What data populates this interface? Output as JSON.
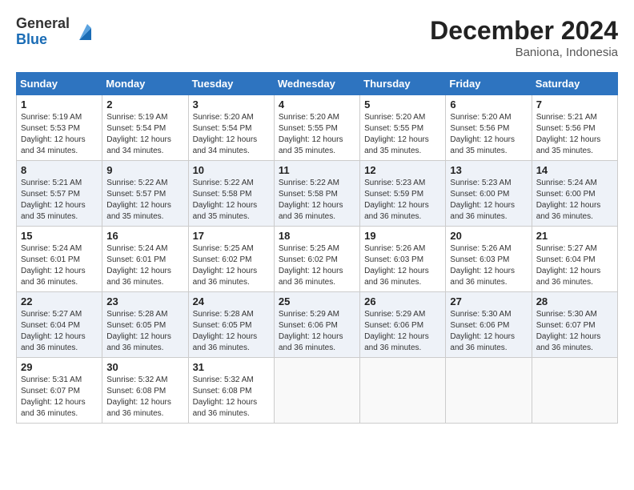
{
  "header": {
    "logo_general": "General",
    "logo_blue": "Blue",
    "month_year": "December 2024",
    "location": "Baniona, Indonesia"
  },
  "weekdays": [
    "Sunday",
    "Monday",
    "Tuesday",
    "Wednesday",
    "Thursday",
    "Friday",
    "Saturday"
  ],
  "weeks": [
    [
      {
        "day": "1",
        "sunrise": "5:19 AM",
        "sunset": "5:53 PM",
        "daylight": "12 hours and 34 minutes."
      },
      {
        "day": "2",
        "sunrise": "5:19 AM",
        "sunset": "5:54 PM",
        "daylight": "12 hours and 34 minutes."
      },
      {
        "day": "3",
        "sunrise": "5:20 AM",
        "sunset": "5:54 PM",
        "daylight": "12 hours and 34 minutes."
      },
      {
        "day": "4",
        "sunrise": "5:20 AM",
        "sunset": "5:55 PM",
        "daylight": "12 hours and 35 minutes."
      },
      {
        "day": "5",
        "sunrise": "5:20 AM",
        "sunset": "5:55 PM",
        "daylight": "12 hours and 35 minutes."
      },
      {
        "day": "6",
        "sunrise": "5:20 AM",
        "sunset": "5:56 PM",
        "daylight": "12 hours and 35 minutes."
      },
      {
        "day": "7",
        "sunrise": "5:21 AM",
        "sunset": "5:56 PM",
        "daylight": "12 hours and 35 minutes."
      }
    ],
    [
      {
        "day": "8",
        "sunrise": "5:21 AM",
        "sunset": "5:57 PM",
        "daylight": "12 hours and 35 minutes."
      },
      {
        "day": "9",
        "sunrise": "5:22 AM",
        "sunset": "5:57 PM",
        "daylight": "12 hours and 35 minutes."
      },
      {
        "day": "10",
        "sunrise": "5:22 AM",
        "sunset": "5:58 PM",
        "daylight": "12 hours and 35 minutes."
      },
      {
        "day": "11",
        "sunrise": "5:22 AM",
        "sunset": "5:58 PM",
        "daylight": "12 hours and 36 minutes."
      },
      {
        "day": "12",
        "sunrise": "5:23 AM",
        "sunset": "5:59 PM",
        "daylight": "12 hours and 36 minutes."
      },
      {
        "day": "13",
        "sunrise": "5:23 AM",
        "sunset": "6:00 PM",
        "daylight": "12 hours and 36 minutes."
      },
      {
        "day": "14",
        "sunrise": "5:24 AM",
        "sunset": "6:00 PM",
        "daylight": "12 hours and 36 minutes."
      }
    ],
    [
      {
        "day": "15",
        "sunrise": "5:24 AM",
        "sunset": "6:01 PM",
        "daylight": "12 hours and 36 minutes."
      },
      {
        "day": "16",
        "sunrise": "5:24 AM",
        "sunset": "6:01 PM",
        "daylight": "12 hours and 36 minutes."
      },
      {
        "day": "17",
        "sunrise": "5:25 AM",
        "sunset": "6:02 PM",
        "daylight": "12 hours and 36 minutes."
      },
      {
        "day": "18",
        "sunrise": "5:25 AM",
        "sunset": "6:02 PM",
        "daylight": "12 hours and 36 minutes."
      },
      {
        "day": "19",
        "sunrise": "5:26 AM",
        "sunset": "6:03 PM",
        "daylight": "12 hours and 36 minutes."
      },
      {
        "day": "20",
        "sunrise": "5:26 AM",
        "sunset": "6:03 PM",
        "daylight": "12 hours and 36 minutes."
      },
      {
        "day": "21",
        "sunrise": "5:27 AM",
        "sunset": "6:04 PM",
        "daylight": "12 hours and 36 minutes."
      }
    ],
    [
      {
        "day": "22",
        "sunrise": "5:27 AM",
        "sunset": "6:04 PM",
        "daylight": "12 hours and 36 minutes."
      },
      {
        "day": "23",
        "sunrise": "5:28 AM",
        "sunset": "6:05 PM",
        "daylight": "12 hours and 36 minutes."
      },
      {
        "day": "24",
        "sunrise": "5:28 AM",
        "sunset": "6:05 PM",
        "daylight": "12 hours and 36 minutes."
      },
      {
        "day": "25",
        "sunrise": "5:29 AM",
        "sunset": "6:06 PM",
        "daylight": "12 hours and 36 minutes."
      },
      {
        "day": "26",
        "sunrise": "5:29 AM",
        "sunset": "6:06 PM",
        "daylight": "12 hours and 36 minutes."
      },
      {
        "day": "27",
        "sunrise": "5:30 AM",
        "sunset": "6:06 PM",
        "daylight": "12 hours and 36 minutes."
      },
      {
        "day": "28",
        "sunrise": "5:30 AM",
        "sunset": "6:07 PM",
        "daylight": "12 hours and 36 minutes."
      }
    ],
    [
      {
        "day": "29",
        "sunrise": "5:31 AM",
        "sunset": "6:07 PM",
        "daylight": "12 hours and 36 minutes."
      },
      {
        "day": "30",
        "sunrise": "5:32 AM",
        "sunset": "6:08 PM",
        "daylight": "12 hours and 36 minutes."
      },
      {
        "day": "31",
        "sunrise": "5:32 AM",
        "sunset": "6:08 PM",
        "daylight": "12 hours and 36 minutes."
      },
      null,
      null,
      null,
      null
    ]
  ],
  "labels": {
    "sunrise": "Sunrise:",
    "sunset": "Sunset:",
    "daylight": "Daylight:"
  }
}
